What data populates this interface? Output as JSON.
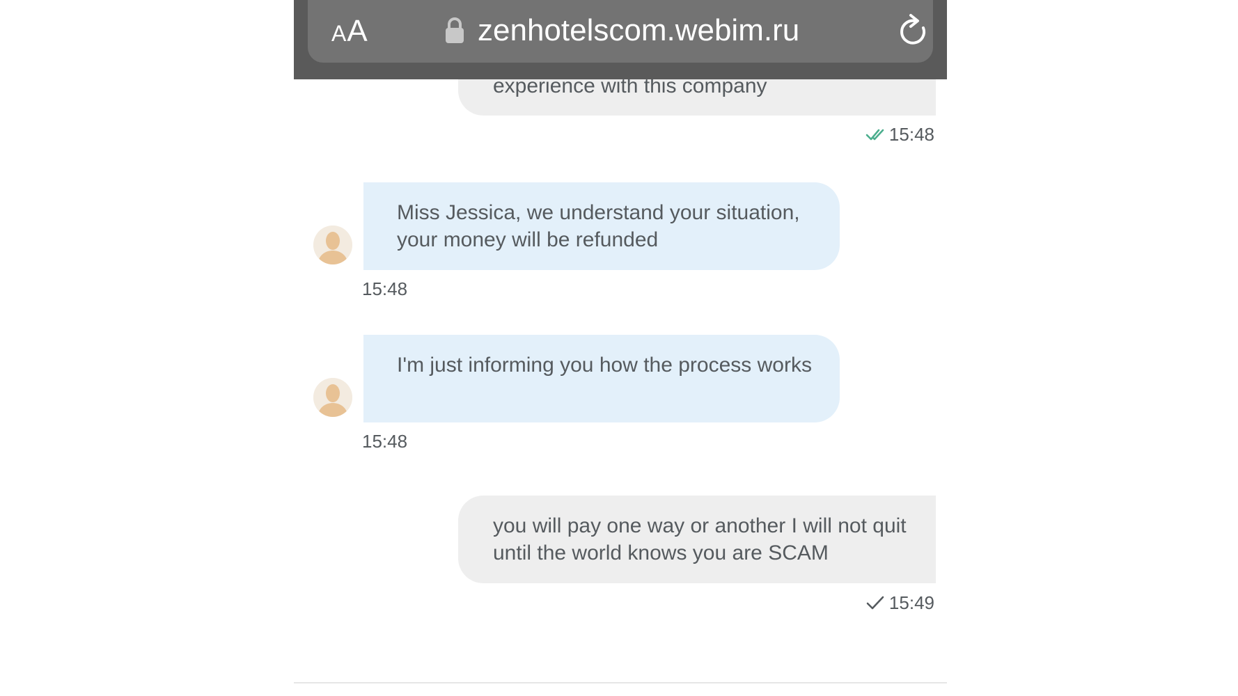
{
  "browser": {
    "text_size_small": "A",
    "text_size_large": "A",
    "url": "zenhotelscom.webim.ru",
    "lock_icon": "lock-icon",
    "reload_icon": "reload-icon"
  },
  "colors": {
    "toolbar": "#5a5a5a",
    "url_pill": "#737373",
    "incoming_bubble": "#e3f0fa",
    "outgoing_bubble": "#eeeeee",
    "read_check": "#4cae8e",
    "text": "#555a5e"
  },
  "messages": [
    {
      "direction": "outgoing",
      "text": "experience with this company",
      "time": "15:48",
      "status": "read"
    },
    {
      "direction": "incoming",
      "text": "Miss Jessica, we understand your situation, your money will be refunded",
      "time": "15:48"
    },
    {
      "direction": "incoming",
      "text": "I'm just informing you how the process works",
      "time": "15:48"
    },
    {
      "direction": "outgoing",
      "text": "you will pay one way or another I will not quit until the world knows you are SCAM",
      "time": "15:49",
      "status": "sent"
    }
  ]
}
